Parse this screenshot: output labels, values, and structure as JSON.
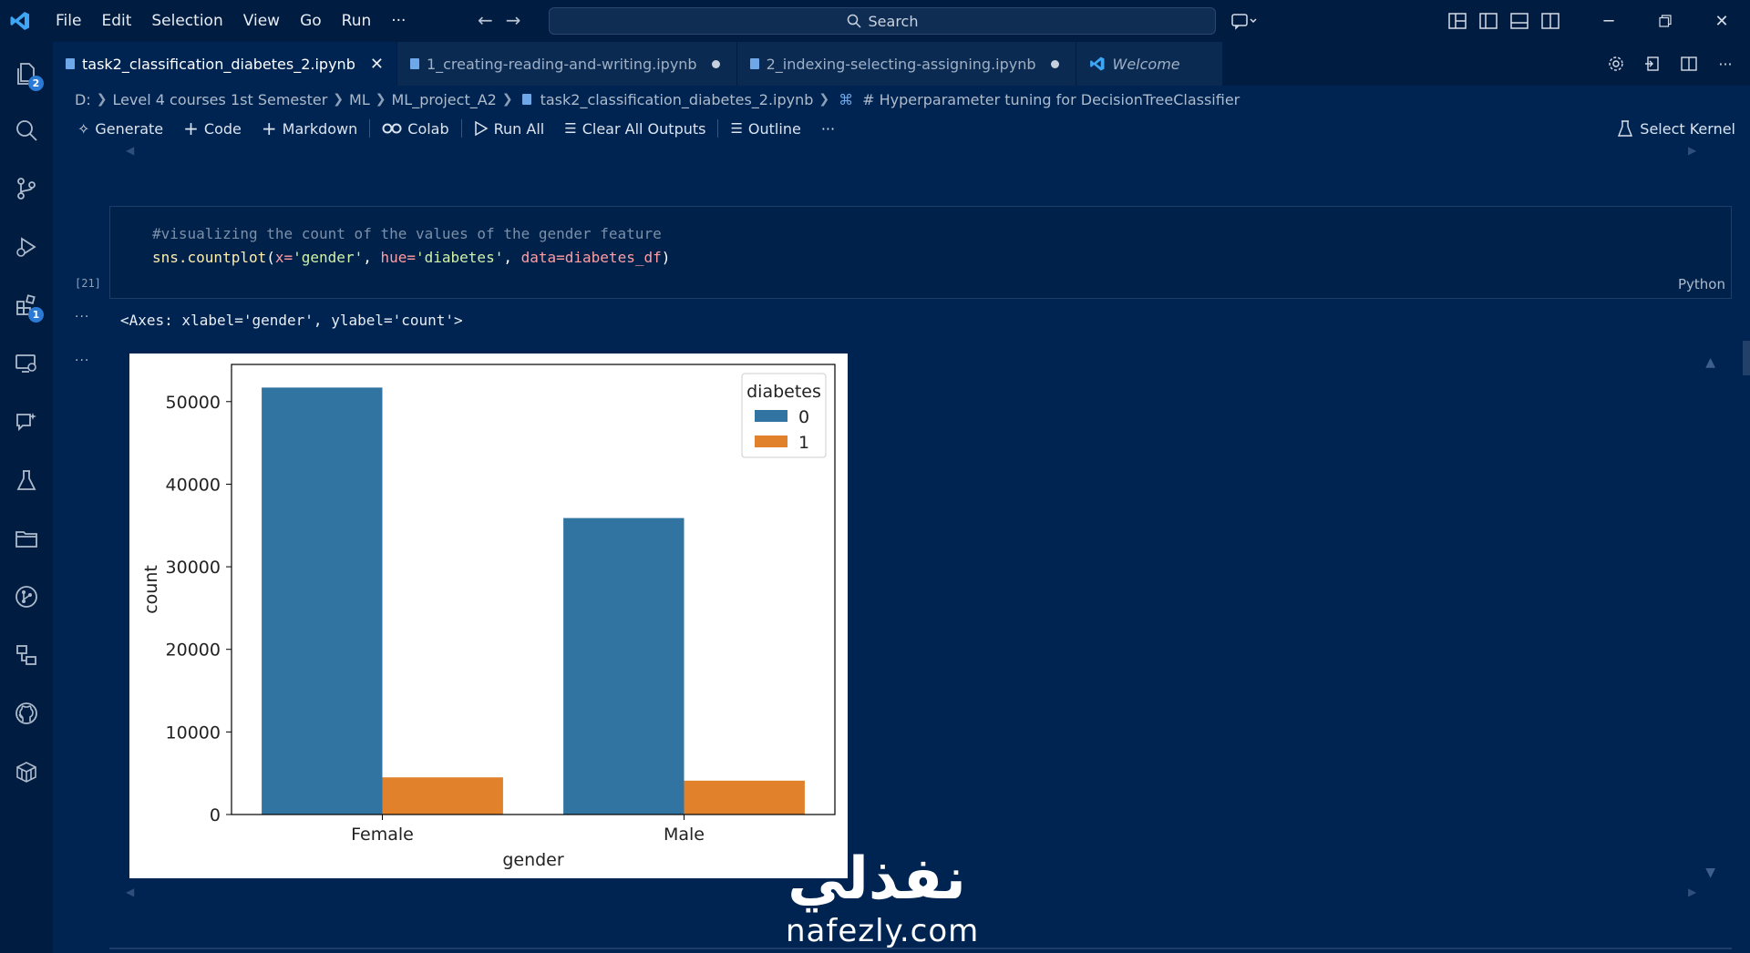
{
  "menu": [
    "File",
    "Edit",
    "Selection",
    "View",
    "Go",
    "Run",
    "···"
  ],
  "search": {
    "label": "Search"
  },
  "activity": {
    "explorer_badge": "2",
    "extensions_badge": "1"
  },
  "tabs": [
    {
      "label": "task2_classification_diabetes_2.ipynb",
      "active": true,
      "close": "✕"
    },
    {
      "label": "1_creating-reading-and-writing.ipynb",
      "dirty": true
    },
    {
      "label": "2_indexing-selecting-assigning.ipynb",
      "dirty": true
    },
    {
      "label": "Welcome"
    }
  ],
  "breadcrumb": [
    "D:",
    "Level 4 courses 1st Semester",
    "ML",
    "ML_project_A2",
    "task2_classification_diabetes_2.ipynb",
    "# Hyperparameter tuning for DecisionTreeClassifier"
  ],
  "toolbar": {
    "generate": "Generate",
    "code": "Code",
    "markdown": "Markdown",
    "colab": "Colab",
    "run_all": "Run All",
    "clear_outputs": "Clear All Outputs",
    "outline": "Outline",
    "more": "···",
    "select_kernel": "Select Kernel"
  },
  "cell": {
    "exec_count": "[21]",
    "comment": "#visualizing the count of the values of the gender feature",
    "code_fn": "sns.countplot",
    "code_open": "(",
    "arg1_key": "x=",
    "arg1_val": "'gender'",
    "comma1": ", ",
    "arg2_key": "hue=",
    "arg2_val": "'diabetes'",
    "comma2": ", ",
    "arg3_key": "data=",
    "arg3_val": "diabetes_df",
    "code_close": ")",
    "language": "Python",
    "output_dots": "···",
    "output_text": "<Axes: xlabel='gender', ylabel='count'>"
  },
  "chart_data": {
    "type": "bar",
    "categories": [
      "Female",
      "Male"
    ],
    "series": [
      {
        "name": "0",
        "values": [
          51700,
          35900
        ],
        "color": "#3274a1"
      },
      {
        "name": "1",
        "values": [
          4500,
          4100
        ],
        "color": "#e1812c"
      }
    ],
    "xlabel": "gender",
    "ylabel": "count",
    "ylim": [
      0,
      54500
    ],
    "yticks": [
      0,
      10000,
      20000,
      30000,
      40000,
      50000
    ],
    "legend_title": "diabetes",
    "legend_position": "top-right",
    "grid": false
  },
  "watermark": {
    "arabic": "نفذلي",
    "latin": "nafezly.com"
  }
}
